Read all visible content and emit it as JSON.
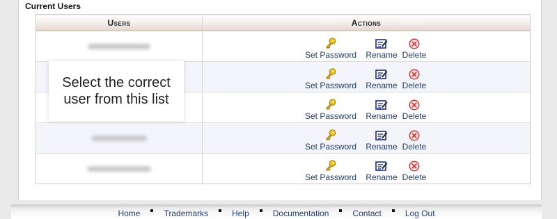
{
  "section": {
    "title": "Current Users"
  },
  "table": {
    "headers": {
      "users": "Users",
      "actions": "Actions"
    },
    "rows": [
      {
        "name_blur_width": 90
      },
      {
        "name_blur_width": 88
      },
      {
        "name_blur_width": 84
      },
      {
        "name_blur_width": 80
      },
      {
        "name_blur_width": 92
      }
    ],
    "actions": {
      "set_password": "Set Password",
      "rename": "Rename",
      "delete": "Delete"
    }
  },
  "callout": {
    "line1": "Select the correct",
    "line2": "user from this list"
  },
  "footer": {
    "links": [
      "Home",
      "Trademarks",
      "Help",
      "Documentation",
      "Contact",
      "Log Out"
    ]
  },
  "icons": {
    "set_password": "key-icon",
    "rename": "rename-icon",
    "delete": "delete-icon"
  }
}
